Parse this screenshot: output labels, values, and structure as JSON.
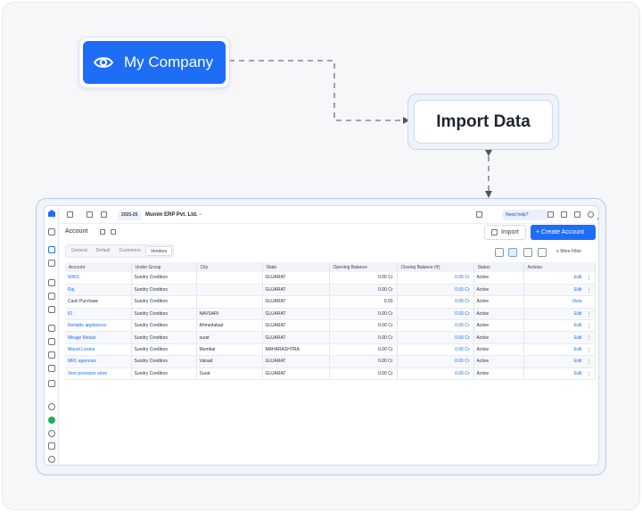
{
  "flow": {
    "source_label": "My Company",
    "target_label": "Import Data"
  },
  "app": {
    "financial_year": "2025-26",
    "company_name": "Munim ERP Pvt. Ltd.",
    "help_label": "Need help?",
    "page_title": "Account",
    "import_label": "Import",
    "create_label": "Create Account",
    "more_filter_label": "More Filter",
    "tabs": [
      "General",
      "Default",
      "Customers",
      "Vendors"
    ],
    "active_tab": "Vendors",
    "columns": [
      "Account",
      "Under Group",
      "City",
      "State",
      "Opening Balance",
      "Closing Balance (₹)",
      "Status",
      "Actions"
    ],
    "rows": [
      {
        "account": "WWS",
        "group": "Sundry Creditors",
        "city": "",
        "state": "GUJARAT",
        "opening": "0.00 Cr",
        "closing": "0.00 Cr",
        "status": "Active",
        "action": "Edit"
      },
      {
        "account": "Raj",
        "group": "Sundry Creditors",
        "city": "",
        "state": "GUJARAT",
        "opening": "0.00 Cr",
        "closing": "0.00 Cr",
        "status": "Active",
        "action": "Edit"
      },
      {
        "account": "Cash Purchase",
        "group": "Sundry Creditors",
        "city": "",
        "state": "GUJARAT",
        "opening": "0.00",
        "closing": "0.00 Cr",
        "status": "Active",
        "action": "View"
      },
      {
        "account": "ID",
        "group": "Sundry Creditors",
        "city": "NAVSARI",
        "state": "GUJARAT",
        "opening": "0.00 Cr",
        "closing": "0.00 Cr",
        "status": "Active",
        "action": "Edit"
      },
      {
        "account": "Reliable appliances",
        "group": "Sundry Creditors",
        "city": "Ahmedabad",
        "state": "GUJARAT",
        "opening": "0.00 Cr",
        "closing": "0.00 Cr",
        "status": "Active",
        "action": "Edit"
      },
      {
        "account": "Mirage Metals",
        "group": "Sundry Creditors",
        "city": "surat",
        "state": "GUJARAT",
        "opening": "0.00 Cr",
        "closing": "0.00 Cr",
        "status": "Active",
        "action": "Edit"
      },
      {
        "account": "Maruti Looms",
        "group": "Sundry Creditors",
        "city": "Mumbai",
        "state": "MAHARASHTRA",
        "opening": "0.00 Cr",
        "closing": "0.00 Cr",
        "status": "Active",
        "action": "Edit"
      },
      {
        "account": "MRL agencies",
        "group": "Sundry Creditors",
        "city": "Valsad",
        "state": "GUJARAT",
        "opening": "0.00 Cr",
        "closing": "0.00 Cr",
        "status": "Active",
        "action": "Edit"
      },
      {
        "account": "Veer provision store",
        "group": "Sundry Creditors",
        "city": "Surat",
        "state": "GUJARAT",
        "opening": "0.00 Cr",
        "closing": "0.00 Cr",
        "status": "Active",
        "action": "Edit"
      }
    ]
  },
  "colors": {
    "accent": "#1d6ef5",
    "text": "#1f2430",
    "border": "#d6dbe5"
  }
}
